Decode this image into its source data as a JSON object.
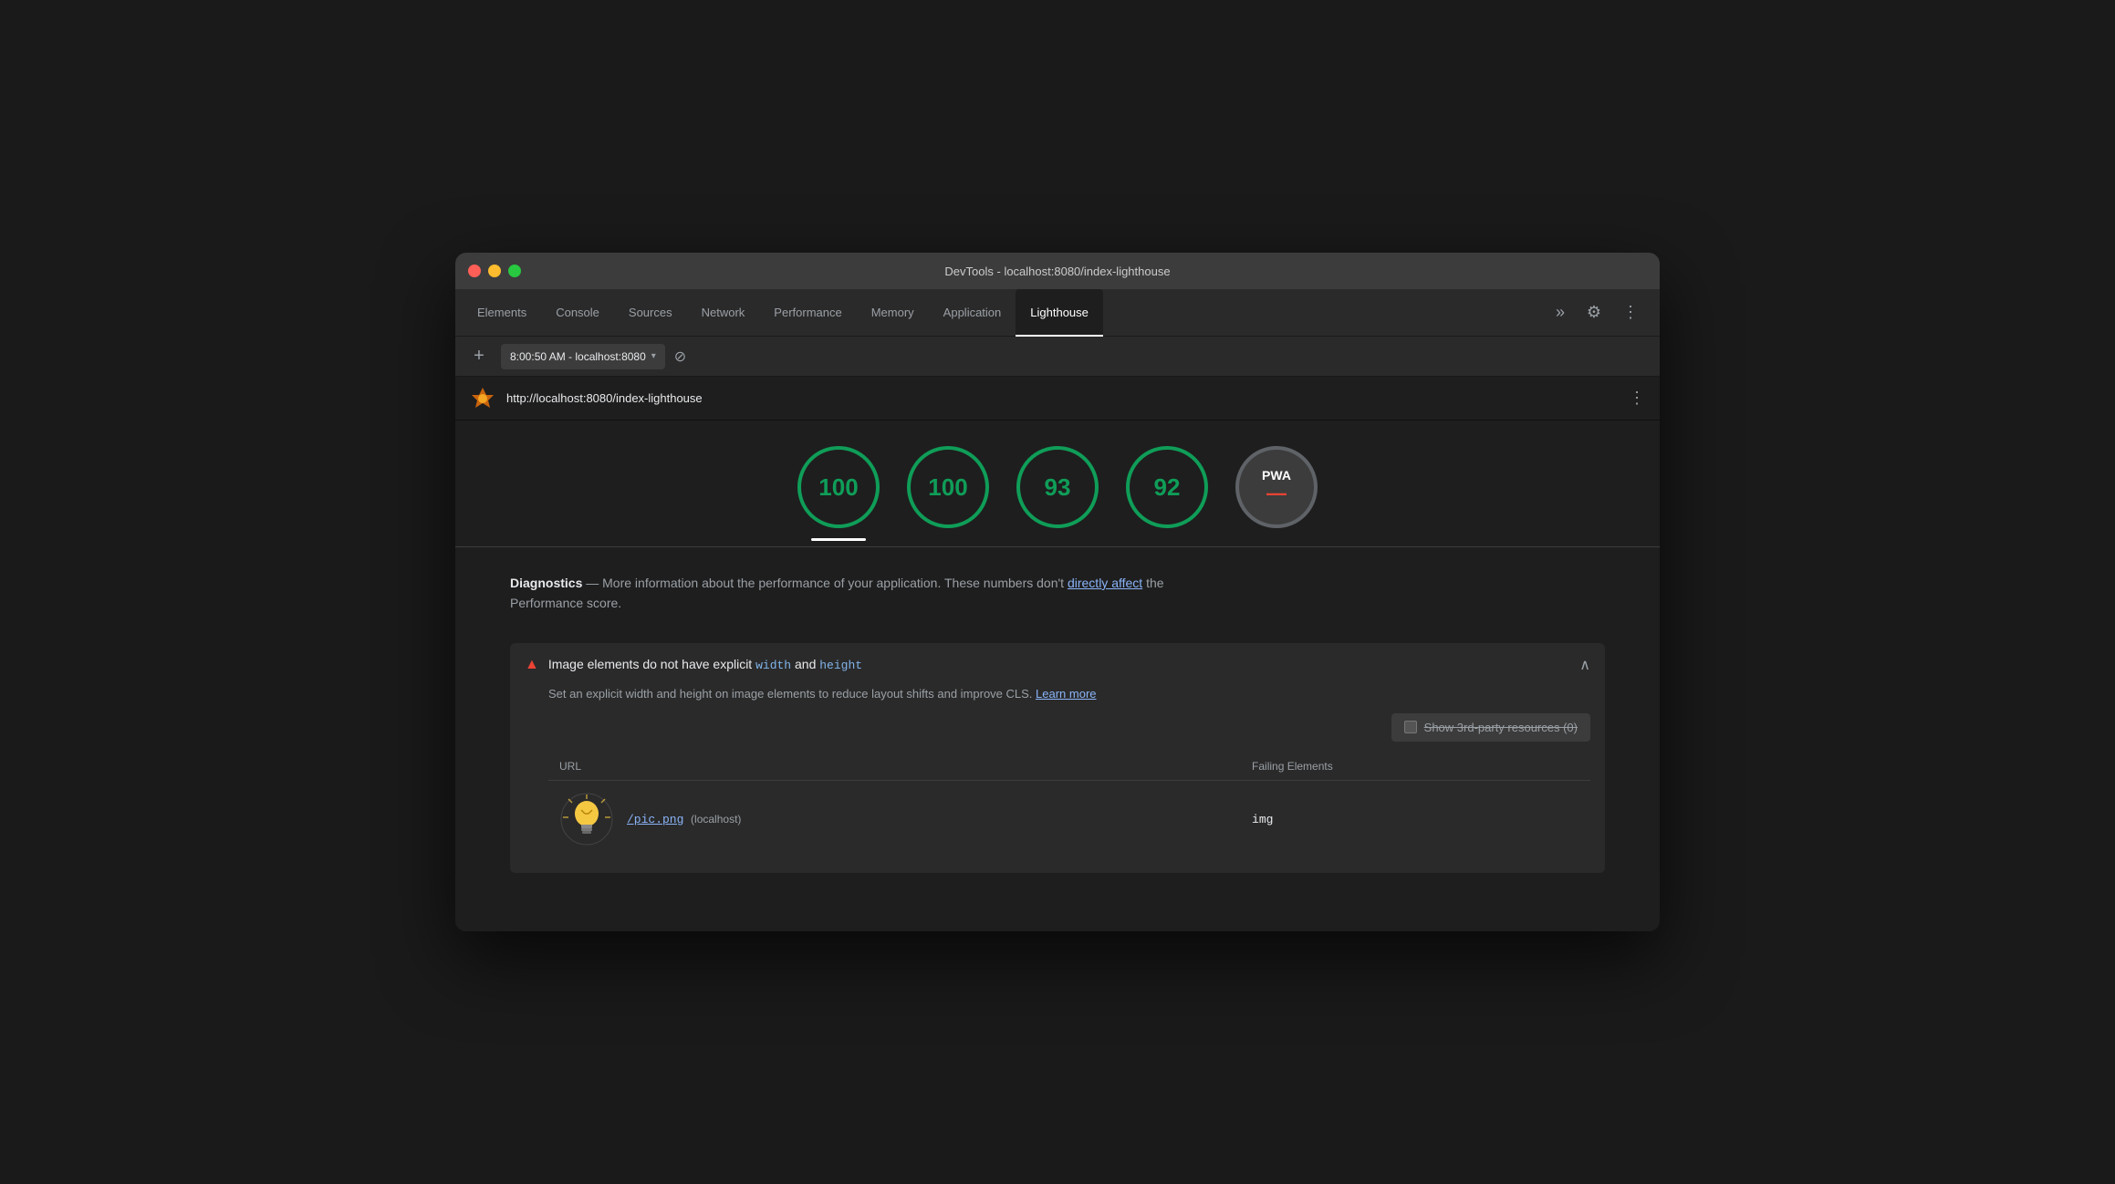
{
  "window": {
    "title": "DevTools - localhost:8080/index-lighthouse"
  },
  "titlebar": {
    "buttons": {
      "close": "close",
      "minimize": "minimize",
      "maximize": "maximize"
    }
  },
  "tabs": [
    {
      "id": "elements",
      "label": "Elements",
      "active": false
    },
    {
      "id": "console",
      "label": "Console",
      "active": false
    },
    {
      "id": "sources",
      "label": "Sources",
      "active": false
    },
    {
      "id": "network",
      "label": "Network",
      "active": false
    },
    {
      "id": "performance",
      "label": "Performance",
      "active": false
    },
    {
      "id": "memory",
      "label": "Memory",
      "active": false
    },
    {
      "id": "application",
      "label": "Application",
      "active": false
    },
    {
      "id": "lighthouse",
      "label": "Lighthouse",
      "active": true
    }
  ],
  "tabs_more": "»",
  "toolbar": {
    "settings_icon": "⚙",
    "more_icon": "⋮"
  },
  "addressbar": {
    "add_icon": "+",
    "url_text": "8:00:50 AM - localhost:8080",
    "dropdown_icon": "▾",
    "stop_icon": "⊘"
  },
  "url_info_bar": {
    "url": "http://localhost:8080/index-lighthouse",
    "more_icon": "⋮"
  },
  "scores": [
    {
      "value": "100",
      "selected": true,
      "is_pwa": false
    },
    {
      "value": "100",
      "selected": false,
      "is_pwa": false
    },
    {
      "value": "93",
      "selected": false,
      "is_pwa": false
    },
    {
      "value": "92",
      "selected": false,
      "is_pwa": false
    },
    {
      "value": "PWA",
      "selected": false,
      "is_pwa": true,
      "dash": "—"
    }
  ],
  "diagnostics": {
    "title": "Diagnostics",
    "separator": "—",
    "description_start": " More information about the performance of your application. These numbers don't ",
    "link_text": "directly affect",
    "description_end": " the",
    "second_line": "Performance score."
  },
  "warning": {
    "title_start": "Image elements do not have explicit ",
    "code_width": "width",
    "title_and": " and ",
    "code_height": "height",
    "description": "Set an explicit width and height on image elements to reduce layout shifts and improve CLS. ",
    "learn_more": "Learn more",
    "show_3p_label": "Show 3rd-party resources (0)",
    "table": {
      "headers": [
        "URL",
        "Failing Elements"
      ],
      "rows": [
        {
          "file_link": "/pic.png",
          "file_host": "(localhost)",
          "failing_element": "img"
        }
      ]
    }
  }
}
